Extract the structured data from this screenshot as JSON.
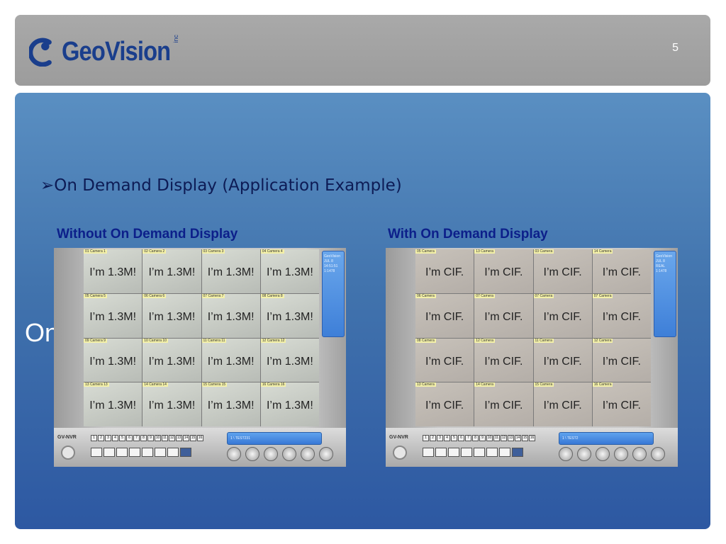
{
  "header": {
    "logo_text": "GeoVision",
    "logo_suffix": "inc",
    "page_number": "5"
  },
  "slide": {
    "bullet_marker": "➢",
    "bullet_text": "On Demand Display (Application Example)",
    "partial_hidden_text": "On"
  },
  "left_shot": {
    "caption": "Without On Demand Display",
    "cell_text": "I’m 1.3M!",
    "cells": [
      {
        "tag": "01 Camera 1"
      },
      {
        "tag": "02 Camera 2"
      },
      {
        "tag": "03 Camera 3"
      },
      {
        "tag": "04 Camera 4"
      },
      {
        "tag": "05 Camera 5"
      },
      {
        "tag": "06 Camera 6"
      },
      {
        "tag": "07 Camera 7"
      },
      {
        "tag": "08 Camera 8"
      },
      {
        "tag": "09 Camera 9"
      },
      {
        "tag": "10 Camera 10"
      },
      {
        "tag": "11 Camera 11"
      },
      {
        "tag": "12 Camera 12"
      },
      {
        "tag": "13 Camera 13"
      },
      {
        "tag": "14 Camera 14"
      },
      {
        "tag": "15 Camera 15"
      },
      {
        "tag": "16 Camera 16"
      }
    ],
    "side_panel": [
      "GeoVision",
      "JUL 8",
      "14:51:51",
      "1:1478"
    ],
    "brand": "GV-NVR",
    "status_text": "1 \\ TEST231"
  },
  "right_shot": {
    "caption": "With On Demand Display",
    "cell_text": "I’m CIF.",
    "cells": [
      {
        "tag": "05 Camera"
      },
      {
        "tag": "13 Camera"
      },
      {
        "tag": "03 Camera"
      },
      {
        "tag": "14 Camera"
      },
      {
        "tag": "06 Camera"
      },
      {
        "tag": "07 Camera"
      },
      {
        "tag": "07 Camera"
      },
      {
        "tag": "07 Camera"
      },
      {
        "tag": "08 Camera"
      },
      {
        "tag": "12 Camera"
      },
      {
        "tag": "11 Camera"
      },
      {
        "tag": "12 Camera"
      },
      {
        "tag": "13 Camera"
      },
      {
        "tag": "14 Camera"
      },
      {
        "tag": "15 Camera"
      },
      {
        "tag": "16 Camera"
      }
    ],
    "side_panel": [
      "GeoVision",
      "JUL 8",
      "REAL",
      "1:1478"
    ],
    "brand": "GV-NVR",
    "status_text": "1 \\ TEST2"
  },
  "camera_numbers": [
    "1",
    "2",
    "3",
    "4",
    "5",
    "6",
    "7",
    "8",
    "9",
    "10",
    "11",
    "12",
    "13",
    "14",
    "15",
    "16"
  ],
  "colors": {
    "brand_blue": "#1a3e8c",
    "panel_top": "#5a8fc2",
    "panel_bottom": "#2d58a2",
    "caption": "#0c1f8a"
  }
}
